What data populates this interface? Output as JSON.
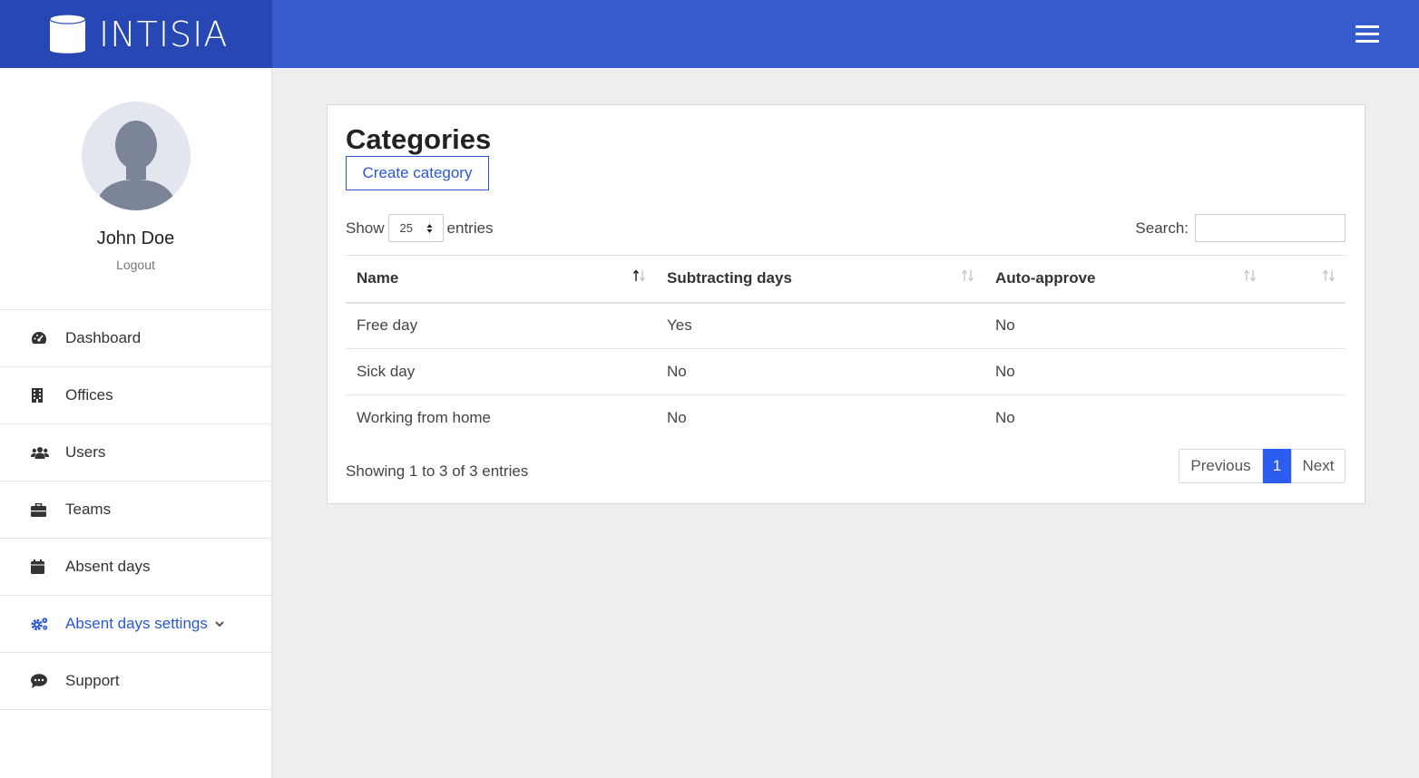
{
  "brand": {
    "name": "INTISIA",
    "logo_icon": "database-cylinder-icon"
  },
  "header": {
    "menu_icon": "hamburger-icon"
  },
  "user": {
    "name": "John Doe",
    "logout_label": "Logout"
  },
  "sidebar": {
    "items": [
      {
        "label": "Dashboard",
        "icon": "tachometer-icon"
      },
      {
        "label": "Offices",
        "icon": "building-icon"
      },
      {
        "label": "Users",
        "icon": "users-icon"
      },
      {
        "label": "Teams",
        "icon": "briefcase-icon"
      },
      {
        "label": "Absent days",
        "icon": "calendar-icon"
      },
      {
        "label": "Absent days settings",
        "icon": "cogs-icon",
        "active": true,
        "has_dropdown": true
      },
      {
        "label": "Support",
        "icon": "comment-dots-icon"
      }
    ]
  },
  "colors": {
    "brand_dark": "#2747b4",
    "topbar": "#355bcd",
    "accent": "#2a57d6",
    "pager_active": "#2c5cf0",
    "background": "#eeeeee"
  },
  "page": {
    "title": "Categories",
    "create_button": "Create category",
    "show_label": "Show",
    "page_length": "25",
    "entries_label": "entries",
    "search_label": "Search:",
    "search_value": "",
    "columns": [
      "Name",
      "Subtracting days",
      "Auto-approve",
      ""
    ],
    "rows": [
      [
        "Free day",
        "Yes",
        "No",
        ""
      ],
      [
        "Sick day",
        "No",
        "No",
        ""
      ],
      [
        "Working from home",
        "No",
        "No",
        ""
      ]
    ],
    "info": "Showing 1 to 3 of 3 entries",
    "pagination": {
      "previous": "Previous",
      "current": "1",
      "next": "Next"
    }
  }
}
